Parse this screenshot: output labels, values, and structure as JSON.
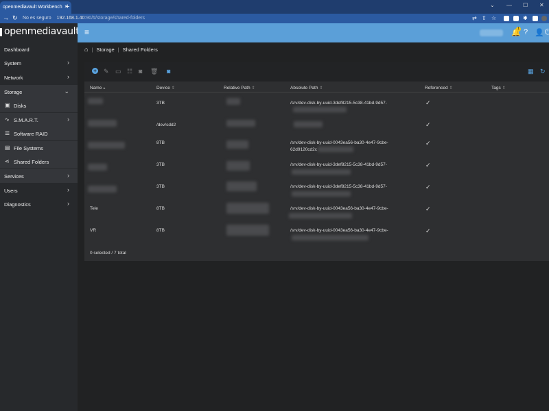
{
  "browser": {
    "tab_title": "openmediavault Workbench",
    "tab_close": "×",
    "new_tab": "+",
    "security_label": "No es seguro",
    "url_host": "192.168.1.40",
    "url_path": ":90/#/storage/shared-folders"
  },
  "brand": {
    "logo_text": "openmediavault"
  },
  "sidebar": {
    "items": [
      {
        "label": "Dashboard"
      },
      {
        "label": "System"
      },
      {
        "label": "Network"
      },
      {
        "label": "Storage"
      },
      {
        "label": "Disks"
      },
      {
        "label": "S.M.A.R.T."
      },
      {
        "label": "Software RAID"
      },
      {
        "label": "File Systems"
      },
      {
        "label": "Shared Folders"
      },
      {
        "label": "Services"
      },
      {
        "label": "Users"
      },
      {
        "label": "Diagnostics"
      }
    ]
  },
  "header": {
    "notification_count": "1"
  },
  "breadcrumb": {
    "storage": "Storage",
    "shared_folders": "Shared Folders"
  },
  "table": {
    "columns": [
      "Name",
      "Device",
      "Relative Path",
      "Absolute Path",
      "Referenced",
      "Tags"
    ],
    "rows": [
      {
        "name": "",
        "device": "3TB",
        "abs1": "/srv/dev-disk-by-uuid-3def8215-5c38-41bd-9d57-",
        "abs2": ""
      },
      {
        "name": "",
        "device": "/dev/sdd2",
        "abs1": "",
        "abs2": ""
      },
      {
        "name": "",
        "device": "8TB",
        "abs1": "/srv/dev-disk-by-uuid-0043ea56-ba30-4e47-9cbe-",
        "abs2": "62d9120cd2c"
      },
      {
        "name": "",
        "device": "3TB",
        "abs1": "/srv/dev-disk-by-uuid-3def8215-5c38-41bd-9d57-",
        "abs2": ""
      },
      {
        "name": "",
        "device": "3TB",
        "abs1": "/srv/dev-disk-by-uuid-3def8215-5c38-41bd-9d57-",
        "abs2": ""
      },
      {
        "name": "Tele",
        "device": "8TB",
        "abs1": "/srv/dev-disk-by-uuid-0043ea56-ba30-4e47-9cbe-",
        "abs2": ""
      },
      {
        "name": "VR",
        "device": "8TB",
        "abs1": "/srv/dev-disk-by-uuid-0043ea56-ba30-4e47-9cbe-",
        "abs2": ""
      }
    ],
    "check_mark": "✓",
    "footer": "0 selected / 7 total"
  }
}
